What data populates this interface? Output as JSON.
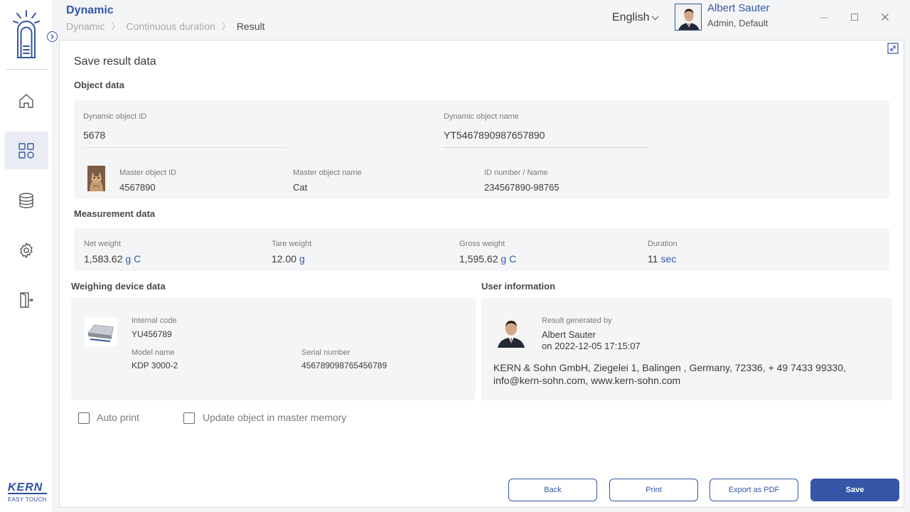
{
  "header": {
    "title": "Dynamic",
    "breadcrumb": [
      "Dynamic",
      "Continuous duration",
      "Result"
    ],
    "language": "English",
    "user_name": "Albert Sauter",
    "user_role": "Admin, Default"
  },
  "sidebar": {
    "items": [
      {
        "icon": "home-icon"
      },
      {
        "icon": "apps-grid-icon",
        "active": true
      },
      {
        "icon": "database-icon"
      },
      {
        "icon": "gear-icon"
      },
      {
        "icon": "logout-icon"
      }
    ],
    "brand_name": "KERN",
    "brand_sub": "EASY TOUCH"
  },
  "page": {
    "title": "Save result data",
    "object_section": "Object data",
    "dyn_id_label": "Dynamic object ID",
    "dyn_id_value": "5678",
    "dyn_name_label": "Dynamic object name",
    "dyn_name_value": "YT5467890987657890",
    "master_id_label": "Master object ID",
    "master_id_value": "4567890",
    "master_name_label": "Master object name",
    "master_name_value": "Cat",
    "id_number_label": "ID number / Name",
    "id_number_value": "234567890-98765",
    "measurement_section": "Measurement data",
    "net_label": "Net weight",
    "net_value": "1,583.62",
    "net_unit": "g C",
    "tare_label": "Tare weight",
    "tare_value": "12.00",
    "tare_unit": "g",
    "gross_label": "Gross weight",
    "gross_value": "1,595.62",
    "gross_unit": "g C",
    "duration_label": "Duration",
    "duration_value": "11",
    "duration_unit": "sec",
    "device_section": "Weighing device data",
    "internal_code_label": "Internal code",
    "internal_code_value": "YU456789",
    "model_label": "Model name",
    "model_value": "KDP 3000-2",
    "serial_label": "Serial number",
    "serial_value": "456789098765456789",
    "user_section": "User information",
    "generated_by_label": "Result generated by",
    "generated_by_value": "Albert Sauter",
    "generated_on": "on 2022-12-05 17:15:07",
    "company_address": "KERN & Sohn GmbH, Ziegelei 1, Balingen , Germany, 72336, + 49 7433 99330, info@kern-sohn.com, www.kern-sohn.com",
    "auto_print_label": "Auto print",
    "update_master_label": "Update object in master memory"
  },
  "buttons": {
    "back": "Back",
    "print": "Print",
    "export_pdf": "Export as PDF",
    "save": "Save"
  },
  "colors": {
    "accent": "#3556a6",
    "card_bg": "#f4f5f7"
  }
}
